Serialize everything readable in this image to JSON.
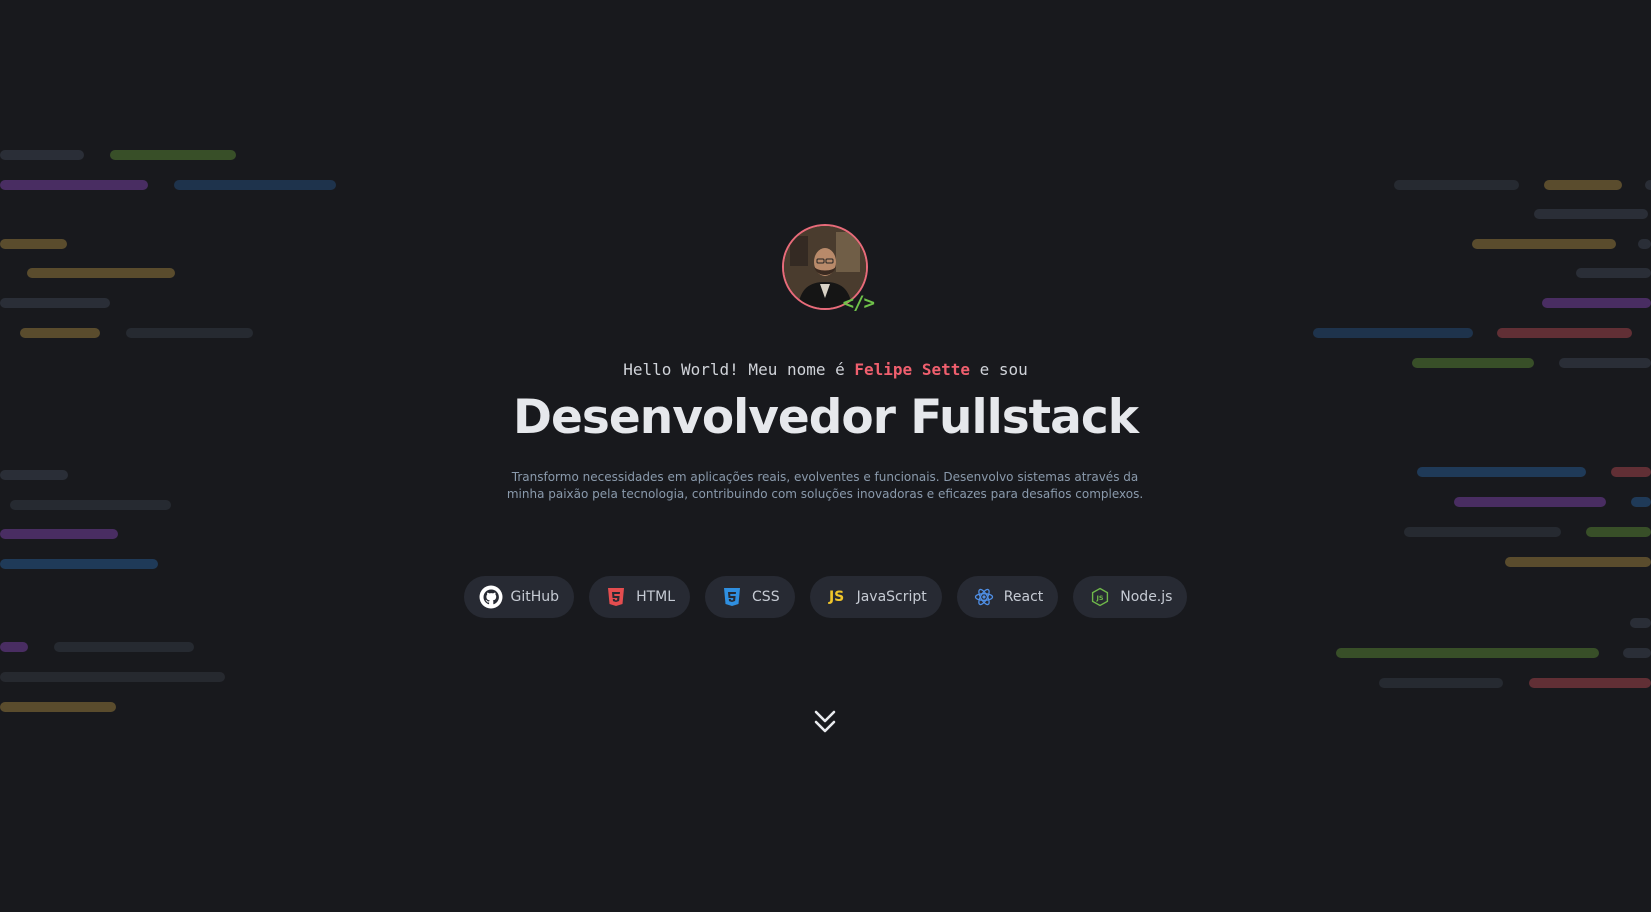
{
  "hero": {
    "greeting_prefix": "Hello World! Meu nome é ",
    "greeting_name": "Felipe Sette",
    "greeting_suffix": " e sou",
    "title": "Desenvolvedor Fullstack",
    "description_line1": "Transformo necessidades em aplicações reais, evolventes e funcionais. Desenvolvo sistemas através da",
    "description_line2": "minha paixão pela tecnologia, contribuindo com soluções inovadoras e eficazes para desafios complexos.",
    "avatar_badge": "</>"
  },
  "skills": [
    {
      "label": "GitHub",
      "icon": "github-icon"
    },
    {
      "label": "HTML",
      "icon": "html5-icon"
    },
    {
      "label": "CSS",
      "icon": "css3-icon"
    },
    {
      "label": "JavaScript",
      "icon": "javascript-icon"
    },
    {
      "label": "React",
      "icon": "react-icon"
    },
    {
      "label": "Node.js",
      "icon": "nodejs-icon"
    }
  ],
  "colors": {
    "background": "#18191d",
    "accent_name": "#ef5f6e",
    "badge_green": "#6fc24a",
    "chip_bg": "#272a33",
    "description": "#8a9aac"
  }
}
